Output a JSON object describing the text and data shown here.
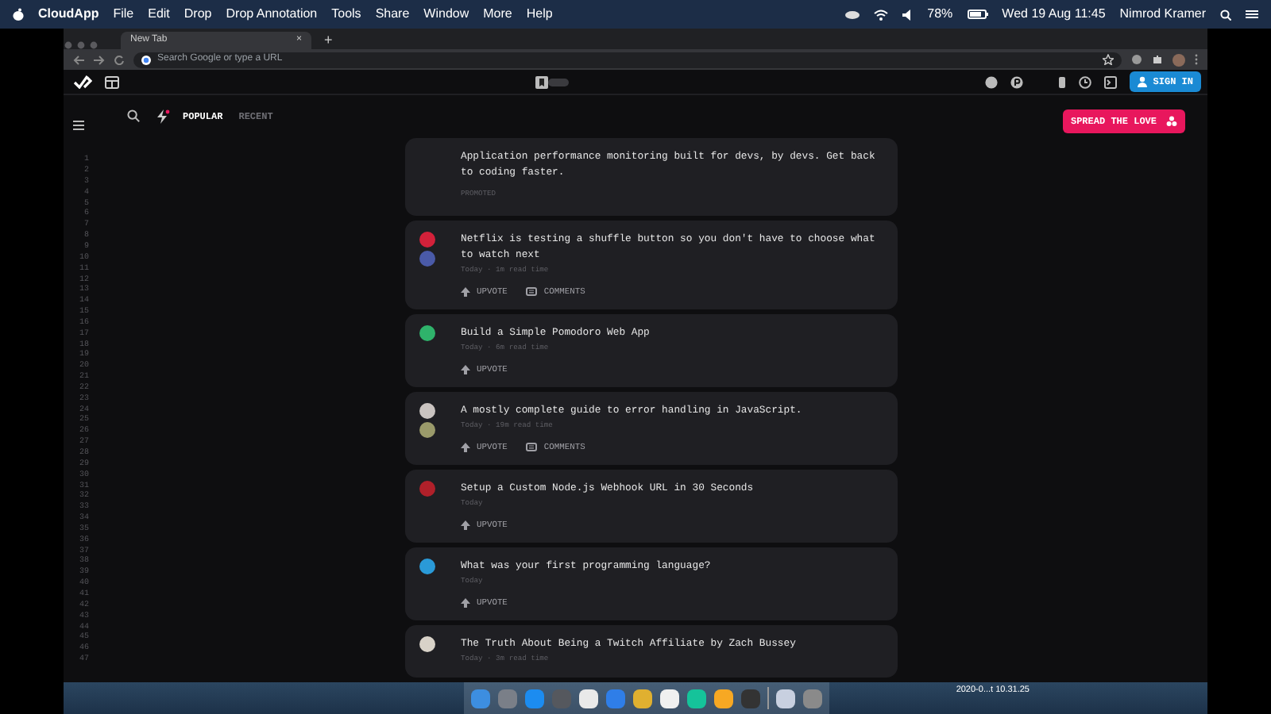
{
  "menu_bar": {
    "app": "CloudApp",
    "menus": [
      "File",
      "Edit",
      "Drop",
      "Drop Annotation",
      "Tools",
      "Share",
      "Window",
      "More",
      "Help"
    ],
    "battery": "78%",
    "clock": "Wed 19 Aug  11:45",
    "user": "Nimrod Kramer"
  },
  "browser": {
    "tab": {
      "title": "New Tab",
      "close": "×"
    },
    "new_tab": "+",
    "address": {
      "placeholder": "Search Google or type a URL"
    }
  },
  "header": {
    "sign_in": "SIGN IN"
  },
  "toolbar": {
    "tabs": [
      {
        "label": "POPULAR",
        "selected": true
      },
      {
        "label": "RECENT",
        "selected": false
      }
    ],
    "spread_button": "SPREAD THE LOVE"
  },
  "line_numbers": [
    "1",
    "2",
    "3",
    "4",
    "5",
    "6",
    "7",
    "8",
    "9",
    "10",
    "11",
    "12",
    "13",
    "14",
    "15",
    "16",
    "17",
    "18",
    "19",
    "20",
    "21",
    "22",
    "23",
    "24",
    "25",
    "26",
    "27",
    "28",
    "29",
    "30",
    "31",
    "32",
    "33",
    "34",
    "35",
    "36",
    "37",
    "38",
    "39",
    "40",
    "41",
    "42",
    "43",
    "44",
    "45",
    "46",
    "47"
  ],
  "posts": [
    {
      "kind": "promoted",
      "title": "Application performance monitoring built for devs, by devs. Get back to coding faster.",
      "label": "PROMOTED"
    },
    {
      "kind": "article",
      "title": "Netflix is testing a shuffle button so you don't have to choose what to watch next",
      "meta": "Today · 1m read time",
      "avatars": [
        {
          "color": "#d3213a"
        },
        {
          "color": "#4a5aa8"
        }
      ],
      "actions": [
        {
          "kind": "upvote",
          "label": "UPVOTE"
        },
        {
          "kind": "comments",
          "label": "COMMENTS"
        }
      ]
    },
    {
      "kind": "article",
      "title": "Build a Simple Pomodoro Web App",
      "meta": "Today · 6m read time",
      "avatars": [
        {
          "color": "#2fb36b"
        }
      ],
      "actions": [
        {
          "kind": "upvote",
          "label": "UPVOTE"
        }
      ]
    },
    {
      "kind": "article",
      "title": "A mostly complete guide to error handling in JavaScript.",
      "meta": "Today · 19m read time",
      "avatars": [
        {
          "color": "#c9c3c0"
        },
        {
          "color": "#9a9a6a"
        }
      ],
      "actions": [
        {
          "kind": "upvote",
          "label": "UPVOTE"
        },
        {
          "kind": "comments",
          "label": "COMMENTS"
        }
      ]
    },
    {
      "kind": "article",
      "title": "Setup a Custom Node.js Webhook URL in 30 Seconds",
      "meta": "Today",
      "avatars": [
        {
          "color": "#b0202a"
        }
      ],
      "actions": [
        {
          "kind": "upvote",
          "label": "UPVOTE"
        }
      ]
    },
    {
      "kind": "article",
      "title": "What was your first programming language?",
      "meta": "Today",
      "avatars": [
        {
          "color": "#2a9ad8"
        }
      ],
      "actions": [
        {
          "kind": "upvote",
          "label": "UPVOTE"
        }
      ]
    },
    {
      "kind": "article",
      "title": "The Truth About Being a Twitch Affiliate by Zach Bussey",
      "meta": "Today · 3m read time",
      "avatars": [
        {
          "color": "#d8d2c8"
        }
      ]
    }
  ],
  "dock": {
    "apps": [
      {
        "color": "#3d8ee0"
      },
      {
        "color": "#7a7f88"
      },
      {
        "color": "#1c8cf0"
      },
      {
        "color": "#55585e"
      },
      {
        "color": "#e9e9e9"
      },
      {
        "color": "#2f7ee8"
      },
      {
        "color": "#e0b030"
      },
      {
        "color": "#f0f0f0"
      },
      {
        "color": "#15c39a"
      },
      {
        "color": "#f7a823"
      },
      {
        "color": "#333333"
      },
      {
        "color": "#c8d0e0"
      },
      {
        "color": "#8a8a8a"
      }
    ],
    "file_label": "2020-0...t 10.31.25"
  }
}
